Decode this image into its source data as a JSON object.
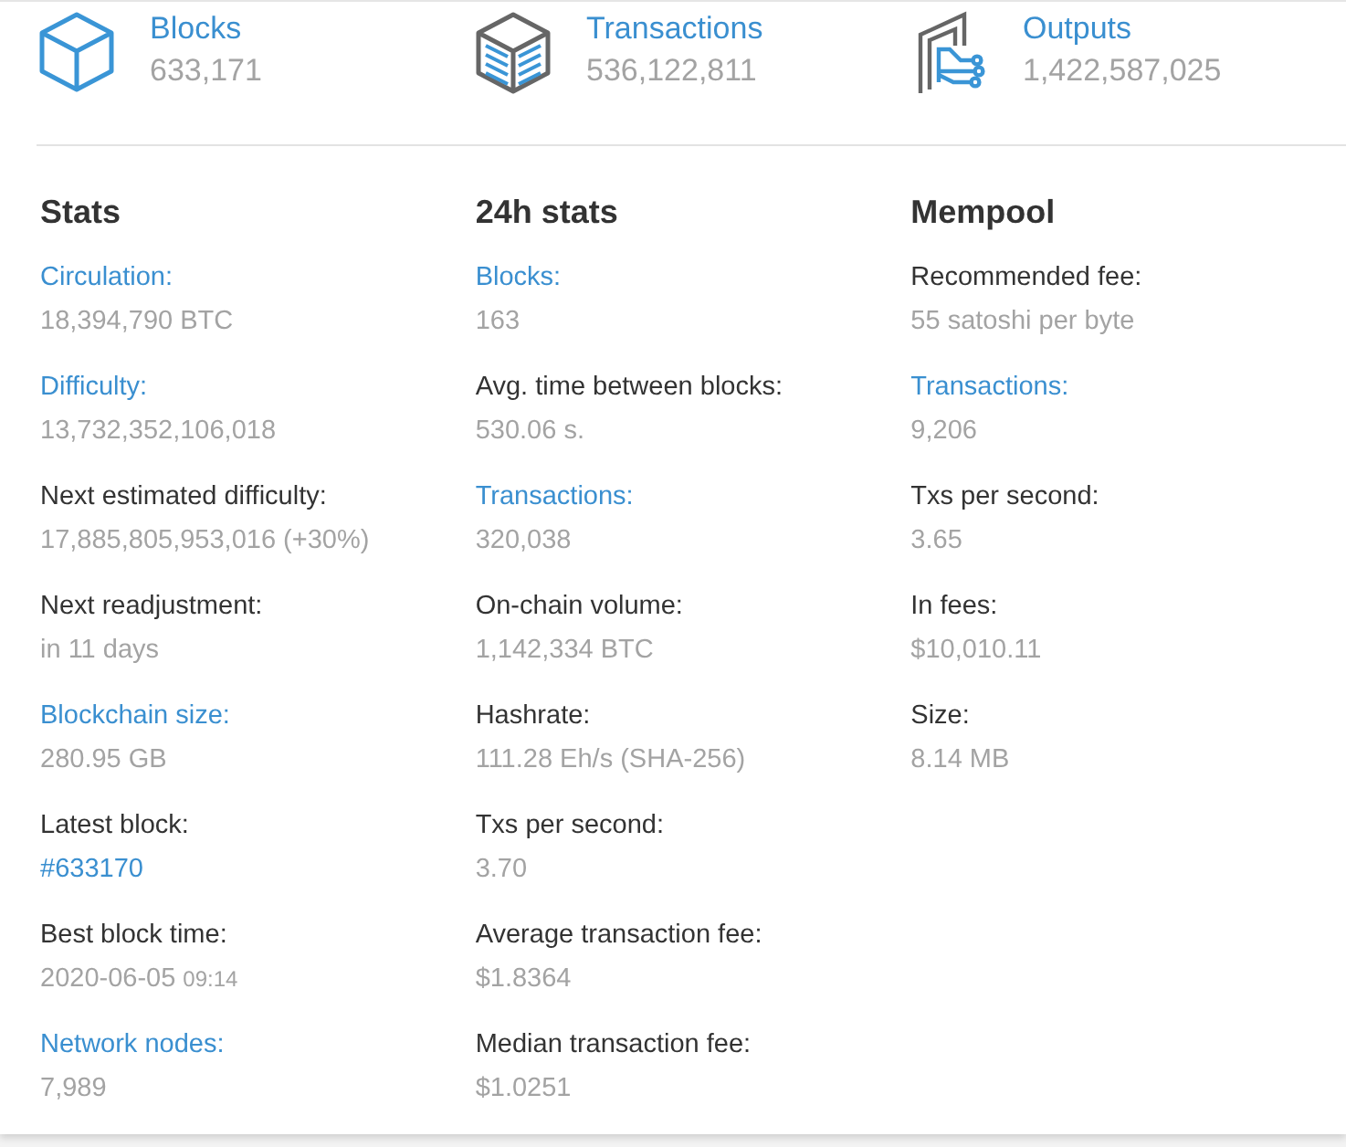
{
  "summary": [
    {
      "kind": "cube",
      "label": "Blocks",
      "value": "633,171"
    },
    {
      "kind": "box",
      "label": "Transactions",
      "value": "536,122,811"
    },
    {
      "kind": "outputs",
      "label": "Outputs",
      "value": "1,422,587,025"
    }
  ],
  "columns": [
    {
      "title": "Stats",
      "items": [
        {
          "label": {
            "kind": "link",
            "text": "Circulation:"
          },
          "value": {
            "kind": "text",
            "text": "18,394,790 BTC"
          }
        },
        {
          "label": {
            "kind": "link",
            "text": "Difficulty:"
          },
          "value": {
            "kind": "text",
            "text": "13,732,352,106,018"
          }
        },
        {
          "label": {
            "kind": "text",
            "text": "Next estimated difficulty:"
          },
          "value": {
            "kind": "text",
            "text": "17,885,805,953,016 (+30%)"
          }
        },
        {
          "label": {
            "kind": "text",
            "text": "Next readjustment:"
          },
          "value": {
            "kind": "text",
            "text": "in 11 days"
          }
        },
        {
          "label": {
            "kind": "link",
            "text": "Blockchain size:"
          },
          "value": {
            "kind": "text",
            "text": "280.95 GB"
          }
        },
        {
          "label": {
            "kind": "text",
            "text": "Latest block:"
          },
          "value": {
            "kind": "link",
            "text": "#633170"
          }
        },
        {
          "label": {
            "kind": "text",
            "text": "Best block time:"
          },
          "value": {
            "kind": "text",
            "text": "2020-06-05",
            "time": "09:14"
          }
        },
        {
          "label": {
            "kind": "link",
            "text": "Network nodes:"
          },
          "value": {
            "kind": "text",
            "text": "7,989"
          }
        }
      ]
    },
    {
      "title": "24h stats",
      "items": [
        {
          "label": {
            "kind": "link",
            "text": "Blocks:"
          },
          "value": {
            "kind": "text",
            "text": "163"
          }
        },
        {
          "label": {
            "kind": "text",
            "text": "Avg. time between blocks:"
          },
          "value": {
            "kind": "text",
            "text": "530.06 s."
          }
        },
        {
          "label": {
            "kind": "link",
            "text": "Transactions:"
          },
          "value": {
            "kind": "text",
            "text": "320,038"
          }
        },
        {
          "label": {
            "kind": "text",
            "text": "On-chain volume:"
          },
          "value": {
            "kind": "text",
            "text": "1,142,334 BTC"
          }
        },
        {
          "label": {
            "kind": "text",
            "text": "Hashrate:"
          },
          "value": {
            "kind": "text",
            "text": "111.28 Eh/s (SHA-256)"
          }
        },
        {
          "label": {
            "kind": "text",
            "text": "Txs per second:"
          },
          "value": {
            "kind": "text",
            "text": "3.70"
          }
        },
        {
          "label": {
            "kind": "text",
            "text": "Average transaction fee:"
          },
          "value": {
            "kind": "text",
            "text": "$1.8364"
          }
        },
        {
          "label": {
            "kind": "text",
            "text": "Median transaction fee:"
          },
          "value": {
            "kind": "text",
            "text": "$1.0251"
          }
        }
      ]
    },
    {
      "title": "Mempool",
      "items": [
        {
          "label": {
            "kind": "text",
            "text": "Recommended fee:"
          },
          "value": {
            "kind": "text",
            "text": "55 satoshi per byte"
          }
        },
        {
          "label": {
            "kind": "link",
            "text": "Transactions:"
          },
          "value": {
            "kind": "text",
            "text": "9,206"
          }
        },
        {
          "label": {
            "kind": "text",
            "text": "Txs per second:"
          },
          "value": {
            "kind": "text",
            "text": "3.65"
          }
        },
        {
          "label": {
            "kind": "text",
            "text": "In fees:"
          },
          "value": {
            "kind": "text",
            "text": "$10,010.11"
          }
        },
        {
          "label": {
            "kind": "text",
            "text": "Size:"
          },
          "value": {
            "kind": "text",
            "text": "8.14 MB"
          }
        }
      ]
    }
  ]
}
